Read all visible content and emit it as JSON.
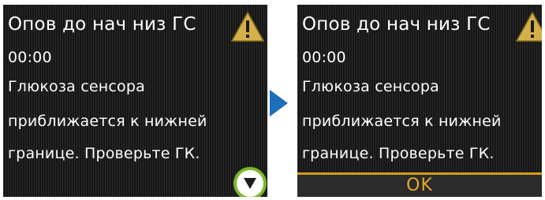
{
  "step1": {
    "title": "Опов до нач низ ГС",
    "time": "00:00",
    "message_lines": [
      "Глюкоза сенсора",
      "приближается к нижней",
      "границе. Проверьте ГК."
    ],
    "warning_icon": "warning-triangle-icon",
    "scroll_icon": "scroll-down-icon"
  },
  "step2": {
    "title": "Опов до нач низ ГС",
    "time": "00:00",
    "message_lines": [
      "Глюкоза сенсора",
      "приближается к нижней",
      "границе. Проверьте ГК."
    ],
    "warning_icon": "warning-triangle-icon",
    "ok_label": "OK"
  },
  "next_icon": "next-step-arrow-icon",
  "colors": {
    "screen_bg": "#1c1c1c",
    "text": "#ffffff",
    "warning": "#d4b04a",
    "ok_accent": "#d39c1e",
    "scroll_ring": "#7ab828",
    "arrow": "#1d6fb8"
  }
}
